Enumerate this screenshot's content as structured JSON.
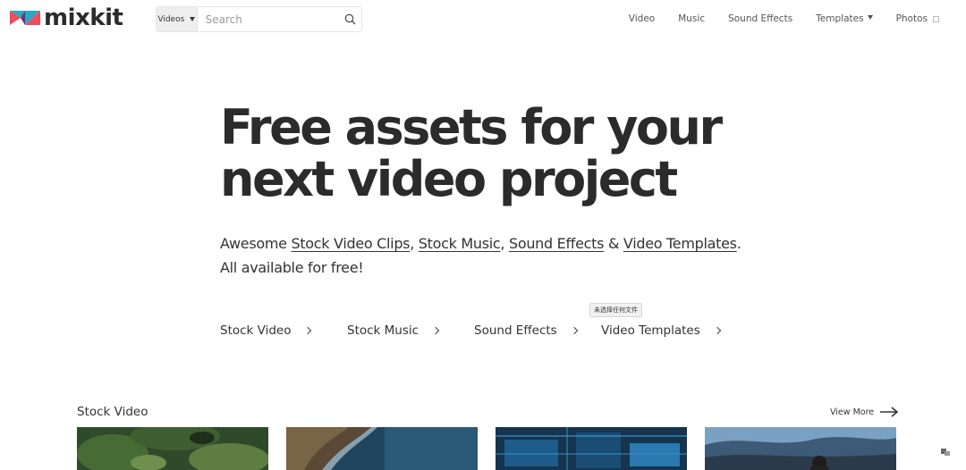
{
  "brand": {
    "name": "mixkit",
    "colors": {
      "coral": "#ef4b5c",
      "teal": "#29a8c1",
      "purple": "#7a2a78",
      "dark": "#2b2b2b"
    }
  },
  "search": {
    "category": "Videos",
    "placeholder": "Search",
    "value": ""
  },
  "nav": {
    "items": [
      {
        "label": "Video"
      },
      {
        "label": "Music"
      },
      {
        "label": "Sound Effects"
      },
      {
        "label": "Templates"
      },
      {
        "label": "Photos"
      }
    ]
  },
  "hero": {
    "title_line1": "Free assets for your",
    "title_line2": "next video project",
    "sub_prefix": "Awesome ",
    "links": [
      "Stock Video Clips",
      "Stock Music",
      "Sound Effects",
      "Video Templates"
    ],
    "sep_comma": ", ",
    "sep_amp": " & ",
    "sub_end": ".",
    "sub_line2": "All available for free!"
  },
  "categories": [
    "Stock Video",
    "Stock Music",
    "Sound Effects",
    "Video Templates"
  ],
  "tooltip": "未选择任何文件",
  "section": {
    "title": "Stock Video",
    "view_more": "View More"
  },
  "icons": {
    "search": "search-icon",
    "dropdown": "chevron-down-icon",
    "external": "external-link-icon",
    "chevron": "chevron-right-icon",
    "arrow": "arrow-right-icon"
  }
}
